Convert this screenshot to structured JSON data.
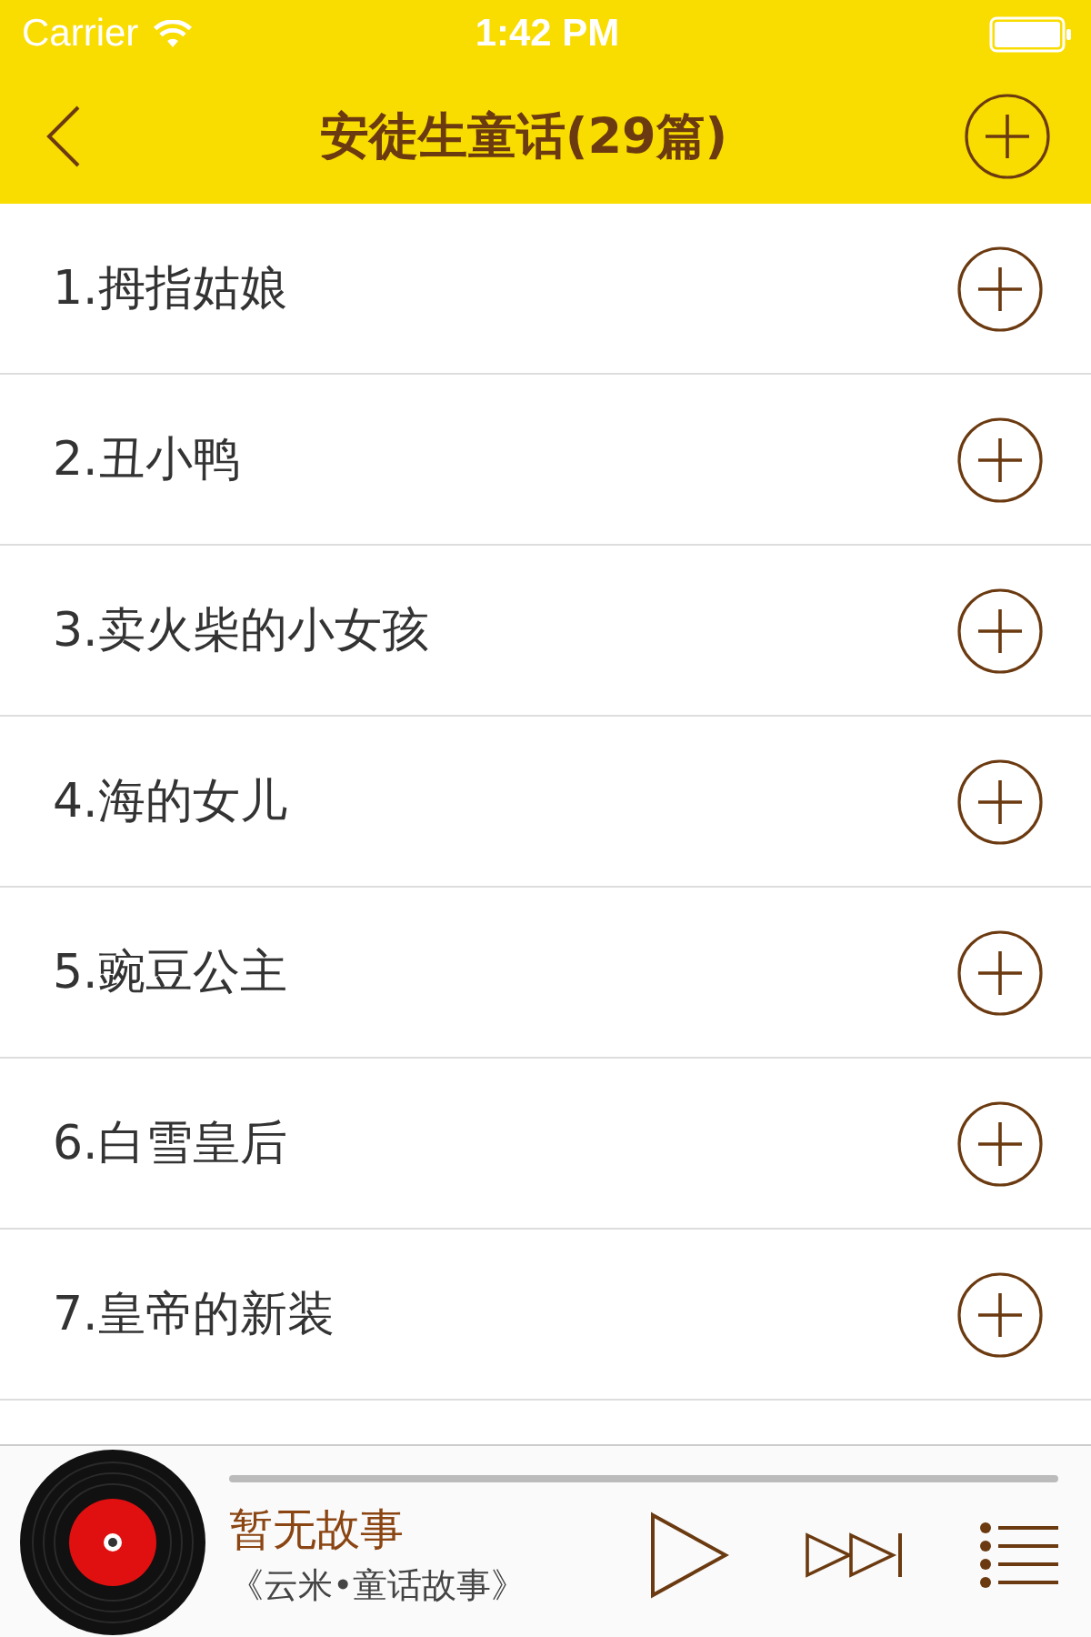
{
  "status_bar": {
    "carrier": "Carrier",
    "time": "1:42 PM"
  },
  "nav": {
    "title": "安徒生童话(29篇)"
  },
  "stories": [
    {
      "title": "1.拇指姑娘"
    },
    {
      "title": "2.丑小鸭"
    },
    {
      "title": "3.卖火柴的小女孩"
    },
    {
      "title": "4.海的女儿"
    },
    {
      "title": "5.豌豆公主"
    },
    {
      "title": "6.白雪皇后"
    },
    {
      "title": "7.皇帝的新装"
    }
  ],
  "player": {
    "title": "暂无故事",
    "subtitle": "《云米•童话故事》"
  }
}
